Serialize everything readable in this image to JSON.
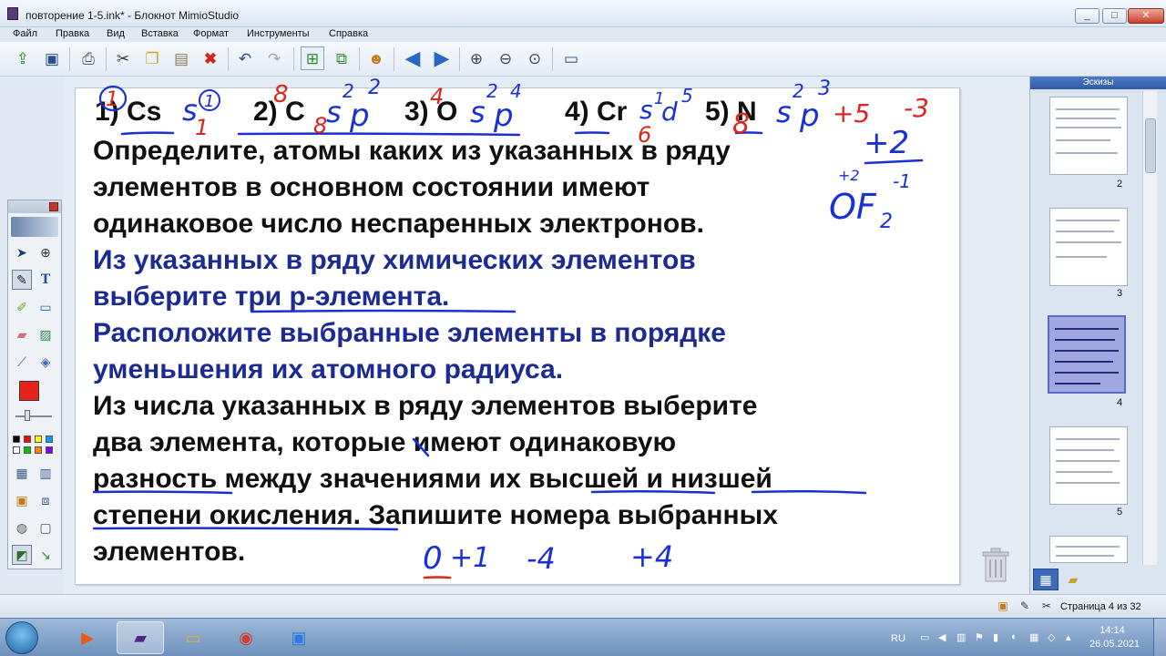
{
  "window": {
    "title": "повторение 1-5.ink* - Блокнот MimioStudio",
    "minimize": "_",
    "maximize": "□",
    "close": "✕"
  },
  "menu": [
    "Файл",
    "Правка",
    "Вид",
    "Вставка",
    "Формат",
    "Инструменты",
    "Справка"
  ],
  "toolbar_icons": [
    "open-icon",
    "save-icon",
    "print-icon",
    "cut-icon",
    "copy-icon",
    "paste-icon",
    "delete-icon",
    "undo-icon",
    "redo-icon",
    "new-page-icon",
    "duplicate-page-icon",
    "collaboration-icon",
    "back-arrow-icon",
    "forward-arrow-icon",
    "zoom-in-icon",
    "zoom-out-icon",
    "zoom-fit-icon",
    "screen-icon"
  ],
  "slide": {
    "options": [
      "1) Cs",
      "2) C",
      "3) O",
      "4) Cr",
      "5) N"
    ],
    "task1": [
      "Определите, атомы каких из указанных в ряду",
      "элементов в основном состоянии имеют",
      "одинаковое число неспаренных электронов."
    ],
    "task2": [
      "Из указанных в ряду химических элементов",
      "выберите три p-элемента."
    ],
    "task3": [
      "Расположите выбранные элементы в порядке",
      "уменьшения их атомного радиуса."
    ],
    "task4": [
      "Из числа указанных в ряду элементов выберите",
      "два элемента, которые имеют одинаковую",
      "разность между значениями их высшей и низшей",
      "степени окисления. Запишите номера выбранных",
      "элементов."
    ],
    "text_colors": {
      "black": "#101010",
      "blue": "#1c2a92"
    }
  },
  "ink": {
    "colors": {
      "blue": "#1a2fd6",
      "red": "#e0231c"
    },
    "blue_marks": [
      "s",
      "1",
      "2",
      "s",
      "2",
      "p",
      "2",
      "s",
      "2",
      "p",
      "4",
      "s",
      "1",
      "d",
      "5",
      "s",
      "2",
      "p",
      "3",
      "+2",
      "+2",
      "-1",
      "OF",
      "2",
      "0",
      "+1",
      "-4",
      "+4"
    ],
    "red_marks": [
      "1",
      "8",
      "1",
      "8",
      "4",
      "6",
      "8",
      "+5",
      "-3"
    ]
  },
  "palette": {
    "tools": [
      "select-icon",
      "zoom-icon",
      "pen-icon",
      "text-icon",
      "highlighter-icon",
      "shape-icon",
      "eraser-icon",
      "image-icon",
      "dropper-icon",
      "fill-icon",
      "spotlight-icon",
      "reveal-icon",
      "mouse-icon",
      "screen-capture-icon",
      "gallery-icon",
      "export-icon"
    ],
    "current_color": "#e8231c",
    "swatches": [
      "#000000",
      "#ff0000",
      "#ffff00",
      "#00a0ff",
      "#ffffff",
      "#00c000",
      "#ff8000",
      "#8000ff"
    ]
  },
  "sketches": {
    "title": "Эскизы",
    "pages": [
      "2",
      "3",
      "4",
      "5"
    ],
    "selected": "4"
  },
  "status": {
    "page_info": "Страница 4 из 32"
  },
  "taskbar": {
    "apps": [
      "mimio-player-icon",
      "mimio-notebook-icon",
      "file-explorer-icon",
      "chrome-icon",
      "zoom-icon"
    ],
    "language": "RU",
    "time": "14:14",
    "date": "26.05.2021"
  }
}
